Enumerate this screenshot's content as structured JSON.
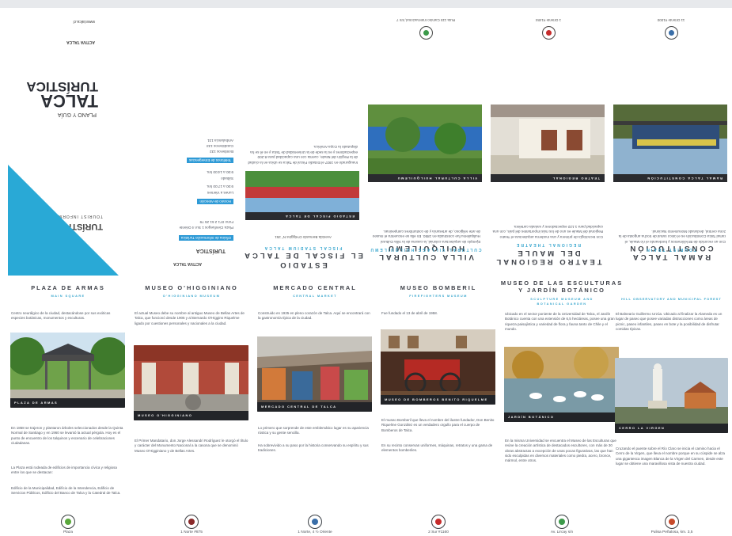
{
  "upper": {
    "cover": {
      "brand_small": "ACTIVA TALCA",
      "plan_title": "PLANO Y GUÍA",
      "talca": "TALCA",
      "turistica": "TURÍSTICA",
      "tourist_info": "TOURIST INFORMATION",
      "oficina_label": "Oficina de Información Turística",
      "address": "Plaza Cienfuegos 1 Sur 4 Oriente Fono 071 2 61 25 79",
      "horario_label": "Horario de Atención",
      "horario_days": "Lunes a Viernes",
      "horario_hours": "9:00 a 17:00 hrs.",
      "sabado": "Sábado",
      "sabado_hours": "9:00 a 14:00 hrs.",
      "emergencias_label": "Teléfonos de Emergencias",
      "emergencias": [
        "Bomberos 132",
        "Carabineros 133",
        "Ambulancia 131"
      ],
      "website": "www.talca.cl"
    },
    "columns": [
      {
        "title": "EL FISCAL DE TALCA",
        "title2": "ESTADIO",
        "sub": "FISCAL STADIUM TALCA",
        "caption": "ESTADIO FISCAL DE TALCA",
        "addr": "Avenida Bernardo O'Higgins N° 251",
        "text": "Inaugurado en 1937 el Estadio Fiscal de Talca se ubica en la ciudad de la Región del Maule, cuenta con una capacidad para 8.200 espectadores y es la sede de la Universidad de Talca y en él se ha disputado la Copa América."
      },
      {
        "title": "VILLA CULTURAL HUILQUILEMU",
        "sub": "CULTURAL VILLAGE HUILQUILEMU",
        "caption": "VILLA CULTURAL HUILQUILEMU",
        "addr": "Ruta 115 Camino Internacional, km 7",
        "text": "Ejemplo de arquitectura colonial, la casona de la Villa Cultural Huilquilemu fue construida en 1850. En ella se encuentra el museo de arte religioso, de artesanía y de costumbres campesinas."
      },
      {
        "title": "TEATRO REGIONAL DEL MAULE",
        "sub": "REGIONAL THEATRE",
        "caption": "TEATRO REGIONAL",
        "addr": "1 Oriente #1484",
        "text": "Con tecnología de primera y una moderna arquitectura el Teatro Regional del Maule es uno de los más importantes del país, con una capacidad para 1.122 espectadores y variada cartelera."
      },
      {
        "title": "RAMAL TALCA CONSTITUCIÓN",
        "sub": "TOURIST TRAIN",
        "caption": "RAMAL TALCA CONSTITUCIÓN",
        "addr": "11 Oriente #1000",
        "text": "Con un recorrido de 88 kilómetros y bordeando el río Maule, el ramal Talca Constitución es el único ramal de trocha angosta de la zona central, declarado Monumento Nacional."
      }
    ]
  },
  "columns": [
    {
      "title_line1": "PLAZA DE ARMAS",
      "title_line2": "",
      "subtitle": "MAIN SQUARE",
      "intro": "Centro neurálgico de la ciudad, destacándose por sus exóticas especies botánicas, monumentos y esculturas.",
      "caption": "PLAZA DE ARMAS",
      "body1": "En 1858 se trajeron y plantaron árboles seleccionados desde la Quinta Normal de Santiago y en 1960 se levantó la actual pérgola. Hoy es el punto de encuentro de los talquinos y escenario de celebraciones ciudadanas.",
      "body2": "La Plaza está rodeada de edificios de importancia cívica y religiosa entre los que se destacan:",
      "body3": "Edificio de la Municipalidad, Edificio de la Intendencia, Edificio de Servicios Públicos, Edificio del Banco de Talca y la Catedral de Talca.",
      "pin_label": "Plaza"
    },
    {
      "title_line1": "MUSEO O'HIGGINIANO",
      "title_line2": "",
      "subtitle": "O'HIGGINIANO MUSEUM",
      "intro": "El actual Museo debe su nombre al antiguo Museo de Bellas Artes de Talca, que funcionó desde 1905 y al Bernardo O'Higgins Riquelme ligado por cuestiones personales y nacionales a la ciudad.",
      "caption": "MUSEO O'HIGGINIANO",
      "body1": "El Primer Mandatario, don Jorge Alessandri Rodríguez le otorgó el título y carácter del Monumento Nacional a la casona que se denominó Museo O'Higginiano y de Bellas Artes.",
      "body2": "",
      "body3": "",
      "pin_label": "1 Norte #875"
    },
    {
      "title_line1": "MERCADO CENTRAL",
      "title_line2": "",
      "subtitle": "CENTRAL MARKET",
      "intro": "Construido en 1935 en pleno corazón de Talca. Aquí se encontrará con la gastronomía típica de la ciudad.",
      "caption": "MERCADO CENTRAL DE TALCA",
      "body1": "Lo primero que sorprende de este emblemático lugar es su apariencia rústica y su gente sencilla.",
      "body2": "Ha sobrevivido a su paso por la historia conservando su espíritu y sus tradiciones.",
      "body3": "",
      "pin_label": "1 Norte, 4 ½ Oriente"
    },
    {
      "title_line1": "MUSEO BOMBERIL",
      "title_line2": "",
      "subtitle": "FIREFIGHTERS MUSEUM",
      "intro": "Fue fundado el 13 de abril de 1958.",
      "caption": "MUSEO DE BOMBEROS BENITO RIQUELME",
      "body1": "El museo Bomberil que lleva el nombre del ilustre fundador, Don Benito Riquelme González es un verdadero orgullo para el cuerpo de Bomberos de Talca.",
      "body2": "En su recinto conservan uniformes, máquinas, retratos y una gama de elementos bomberiles.",
      "body3": "",
      "pin_label": "2 Sur #1160"
    },
    {
      "title_line1": "MUSEO DE LAS ESCULTURAS",
      "title_line2": "Y JARDÍN BOTÁNICO",
      "subtitle": "SCULPTURE MUSEUM AND BOTANICAL GARDEN",
      "intro": "Ubicado en el sector poniente de la Universidad de Talca, el Jardín Botánico cuenta con una extensión de 6,5 hectáreas, posee una gran riqueza paisajística y variedad de flora y fauna tanto de Chile y el mundo.",
      "caption": "JARDÍN BOTÁNICO",
      "body1": "En la misma Universidad se encuentra el Museo de las Esculturas que reúne la creación artística de destacados escultores, con más de 30 obras abstractas a excepción de unas pocas figurativas, las que han sido esculpidas en diversos materiales como piedra, acero, bronce, mármol, entre otros.",
      "body2": "",
      "body3": "",
      "pin_label": "Av. Lircay s/n"
    },
    {
      "title_line1": "",
      "title_line2": "",
      "subtitle": "HILL OBSERVATORY AND MUNICIPAL FOREST",
      "intro": "El Balneario Guillermo Urzúa. Ubicado al finalizar la Alameda es un lugar de paseo que posee variadas distracciones como áreas de picnic, paseo infantiles, paseo en bote y la posibilidad de disfrutar comidas típicas.",
      "caption": "CERRO LA VIRGEN",
      "body1": "Cruzando el puente sobre el Río Claro se inicia el camino hacia el Cerro de la Virgen, que lleva el nombre porque en su cúspide se alza una gigantesca imagen Blanca de la Virgen del Carmen, desde este lugar se obtiene una maravillosa vista de nuestra ciudad.",
      "body2": "",
      "body3": "",
      "pin_label": "Pulisa Peñalosa, km. 3,5"
    }
  ],
  "colors": {
    "accent_blue": "#38a6cd",
    "caption_bg": "#222428",
    "pin_icon_colors": [
      "#5aa83c",
      "#8a2a2a",
      "#3a6ea8",
      "#c62b2b",
      "#3c9a4a",
      "#c74a2a"
    ]
  }
}
